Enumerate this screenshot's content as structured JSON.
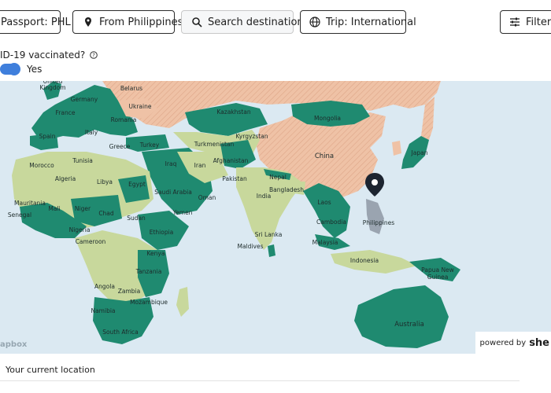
{
  "toolbar": {
    "passport": "Passport: PHL",
    "from": "From Philippines",
    "search": "Search destination",
    "trip": "Trip: International",
    "filters": "Filters"
  },
  "vaccination": {
    "question": "ID-19 vaccinated?",
    "answer": "Yes",
    "toggle_on": true
  },
  "map": {
    "colors": {
      "ocean": "#dbe9f2",
      "open_green": "#1f8a70",
      "visa_on_arrival": "#c8d89c",
      "restricted": "#efc2a6",
      "selected": "#9aa4b0"
    },
    "labels": [
      "United Kingdom",
      "Belarus",
      "Germany",
      "Ukraine",
      "Kazakhstan",
      "France",
      "Romania",
      "Mongolia",
      "Kyrgyzstan",
      "Spain",
      "Italy",
      "Turkey",
      "Turkmenistan",
      "Greece",
      "China",
      "Morocco",
      "Tunisia",
      "Iraq",
      "Iran",
      "Afghanistan",
      "Japan",
      "Nepal",
      "Algeria",
      "Libya",
      "Egypt",
      "Saudi Arabia",
      "Pakistan",
      "Bangladesh",
      "Mauritania",
      "Mali",
      "Niger",
      "Chad",
      "Laos",
      "India",
      "Yemen",
      "Oman",
      "Senegal",
      "Sudan",
      "Philippines",
      "Cambodia",
      "Nigeria",
      "Ethiopia",
      "Sri Lanka",
      "Cameroon",
      "Malaysia",
      "Maldives",
      "Kenya",
      "Indonesia",
      "Tanzania",
      "Papua New Guinea",
      "Angola",
      "Zambia",
      "Mozambique",
      "Namibia",
      "Australia",
      "South Africa"
    ],
    "attribution": "apbox",
    "powered_by": "powered by",
    "brand": "she"
  },
  "footer": {
    "location_label": "Your current location"
  }
}
